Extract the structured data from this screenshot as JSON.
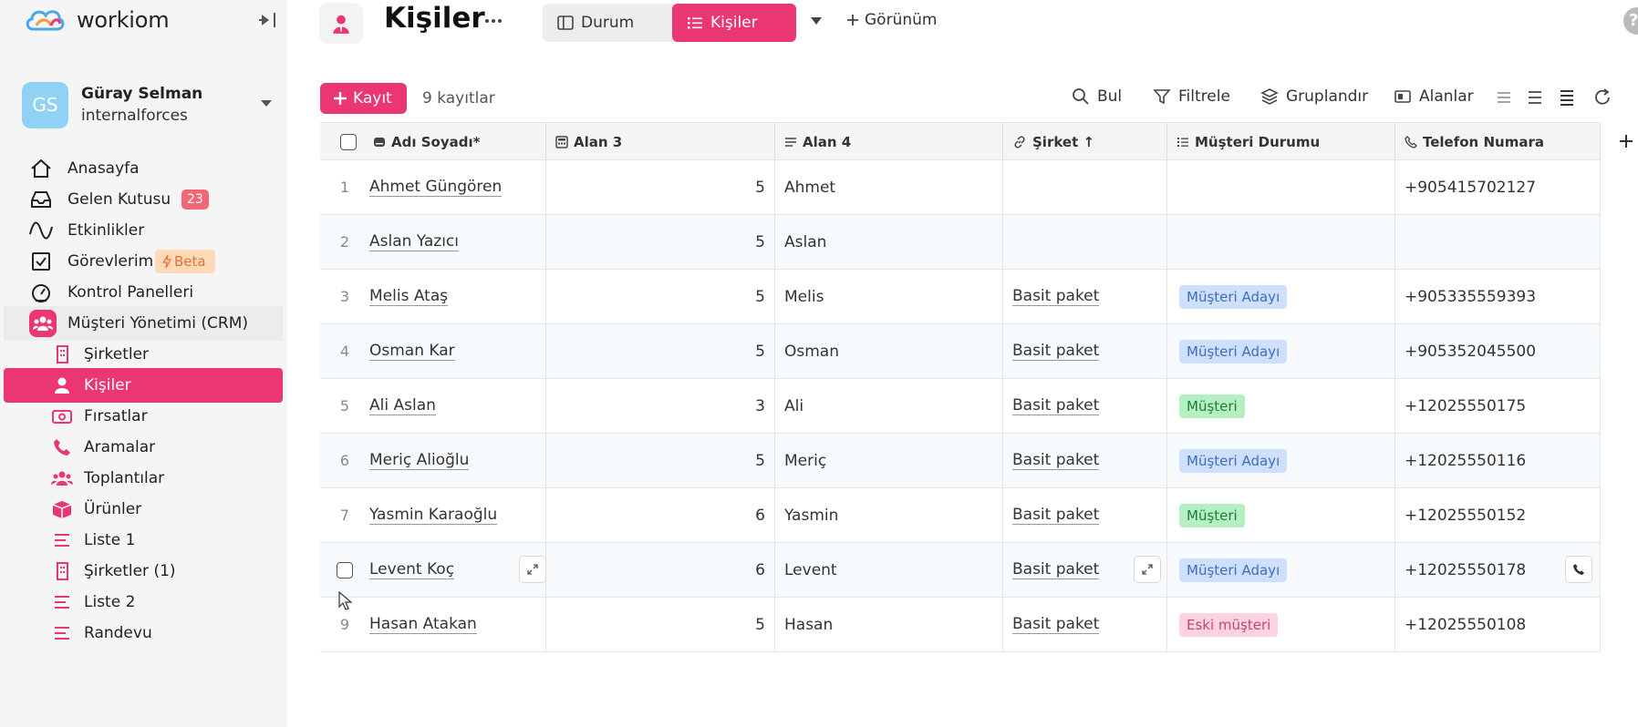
{
  "app": {
    "brand": "workiom"
  },
  "user": {
    "initials": "GS",
    "name": "Güray Selman",
    "org": "internalforces"
  },
  "sidebar": {
    "items": [
      {
        "label": "Anasayfa",
        "icon": "home-icon"
      },
      {
        "label": "Gelen Kutusu",
        "icon": "inbox-icon",
        "badge": "23"
      },
      {
        "label": "Etkinlikler",
        "icon": "activity-icon"
      },
      {
        "label": "Görevlerim",
        "icon": "checkbox-icon",
        "badge": "Beta"
      },
      {
        "label": "Kontrol Panelleri",
        "icon": "gauge-icon"
      },
      {
        "label": "Müşteri Yönetimi (CRM)",
        "icon": "people-icon"
      }
    ],
    "sub_items": [
      {
        "label": "Şirketler",
        "icon": "building-icon"
      },
      {
        "label": "Kişiler",
        "icon": "person-icon"
      },
      {
        "label": "Fırsatlar",
        "icon": "money-icon"
      },
      {
        "label": "Aramalar",
        "icon": "phone-icon"
      },
      {
        "label": "Toplantılar",
        "icon": "people-icon"
      },
      {
        "label": "Ürünler",
        "icon": "box-icon"
      },
      {
        "label": "Liste 1",
        "icon": "list-icon"
      },
      {
        "label": "Şirketler (1)",
        "icon": "building-icon"
      },
      {
        "label": "Liste 2",
        "icon": "list-icon"
      },
      {
        "label": "Randevu",
        "icon": "list-icon"
      }
    ]
  },
  "header": {
    "title": "Kişiler",
    "views": [
      {
        "label": "Durum"
      },
      {
        "label": "Kişiler"
      }
    ],
    "add_view": "Görünüm"
  },
  "toolbar": {
    "record_button": "Kayıt",
    "record_count": "9 kayıtlar",
    "find": "Bul",
    "filter": "Filtrele",
    "group": "Gruplandır",
    "fields": "Alanlar"
  },
  "table": {
    "columns": [
      {
        "label": "Adı Soyadı*"
      },
      {
        "label": "Alan 3"
      },
      {
        "label": "Alan 4"
      },
      {
        "label": "Şirket ↑"
      },
      {
        "label": "Müşteri Durumu"
      },
      {
        "label": "Telefon Numara"
      }
    ],
    "rows": [
      {
        "num": "1",
        "name": "Ahmet Güngören",
        "alan3": "5",
        "alan4": "Ahmet",
        "sirket": "",
        "durum": "",
        "durum_type": "",
        "tel": "+905415702127"
      },
      {
        "num": "2",
        "name": "Aslan Yazıcı",
        "alan3": "5",
        "alan4": "Aslan",
        "sirket": "",
        "durum": "",
        "durum_type": "",
        "tel": ""
      },
      {
        "num": "3",
        "name": "Melis Ataş",
        "alan3": "5",
        "alan4": "Melis",
        "sirket": "Basit paket",
        "durum": "Müşteri Adayı",
        "durum_type": "aday",
        "tel": "+905335559393"
      },
      {
        "num": "4",
        "name": "Osman Kar",
        "alan3": "5",
        "alan4": "Osman",
        "sirket": "Basit paket",
        "durum": "Müşteri Adayı",
        "durum_type": "aday",
        "tel": "+905352045500"
      },
      {
        "num": "5",
        "name": "Ali Aslan",
        "alan3": "3",
        "alan4": "Ali",
        "sirket": "Basit paket",
        "durum": "Müşteri",
        "durum_type": "musteri",
        "tel": "+12025550175"
      },
      {
        "num": "6",
        "name": "Meriç Alioğlu",
        "alan3": "5",
        "alan4": "Meriç",
        "sirket": "Basit paket",
        "durum": "Müşteri Adayı",
        "durum_type": "aday",
        "tel": "+12025550116"
      },
      {
        "num": "7",
        "name": "Yasmin Karaoğlu",
        "alan3": "6",
        "alan4": "Yasmin",
        "sirket": "Basit paket",
        "durum": "Müşteri",
        "durum_type": "musteri",
        "tel": "+12025550152"
      },
      {
        "num": "",
        "name": "Levent Koç",
        "alan3": "6",
        "alan4": "Levent",
        "sirket": "Basit paket",
        "durum": "Müşteri Adayı",
        "durum_type": "aday",
        "tel": "+12025550178"
      },
      {
        "num": "9",
        "name": "Hasan Atakan",
        "alan3": "5",
        "alan4": "Hasan",
        "sirket": "Basit paket",
        "durum": "Eski müşteri",
        "durum_type": "eski",
        "tel": "+12025550108"
      }
    ]
  },
  "colors": {
    "accent": "#ea3772",
    "avatar": "#8fd2f5"
  }
}
